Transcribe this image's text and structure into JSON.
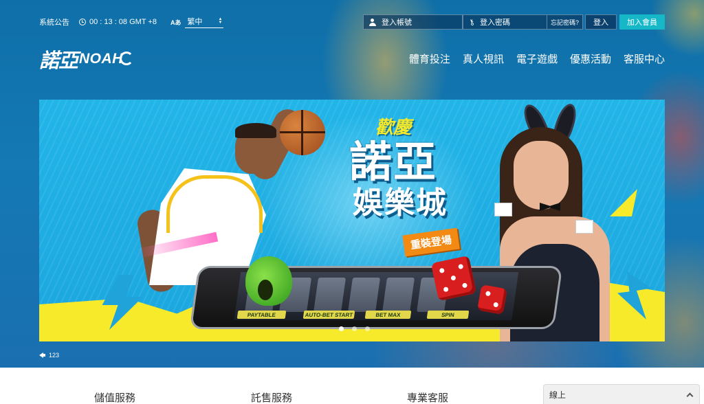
{
  "topbar": {
    "announcement": "系統公告",
    "time": "00 : 13 : 08 GMT +8",
    "language_icon": "Aあ",
    "language": "繁中",
    "username_placeholder": "登入帳號",
    "password_placeholder": "登入密碼",
    "forgot": "忘記密碼?",
    "login": "登入",
    "join": "加入會員"
  },
  "logo": {
    "cn": "諾亞",
    "en": "NOAH"
  },
  "nav": [
    {
      "label": "體育投注"
    },
    {
      "label": "真人視訊"
    },
    {
      "label": "電子遊戲"
    },
    {
      "label": "優惠活動"
    },
    {
      "label": "客服中心"
    }
  ],
  "banner": {
    "small": "歡慶",
    "big": "諾亞",
    "mid": "娛樂城",
    "tag": "重裝登場",
    "game_buttons": [
      "PAYTABLE",
      "AUTO-BET START",
      "BET MAX",
      "SPIN"
    ],
    "slide_count": 3,
    "active_slide": 0
  },
  "sound": {
    "label": "123"
  },
  "services": [
    {
      "label": "儲值服務"
    },
    {
      "label": "託售服務"
    },
    {
      "label": "專業客服"
    }
  ],
  "chat": {
    "label": "線上"
  },
  "colors": {
    "accent": "#16b8c8",
    "background": "#1479b4",
    "banner": "#22b5e8",
    "yellow": "#f7ea2a"
  },
  "icons": {
    "clock": "clock-icon",
    "language": "language-icon",
    "user": "user-icon",
    "key": "key-icon",
    "speaker": "speaker-icon",
    "chevron": "chevron-up-icon"
  }
}
